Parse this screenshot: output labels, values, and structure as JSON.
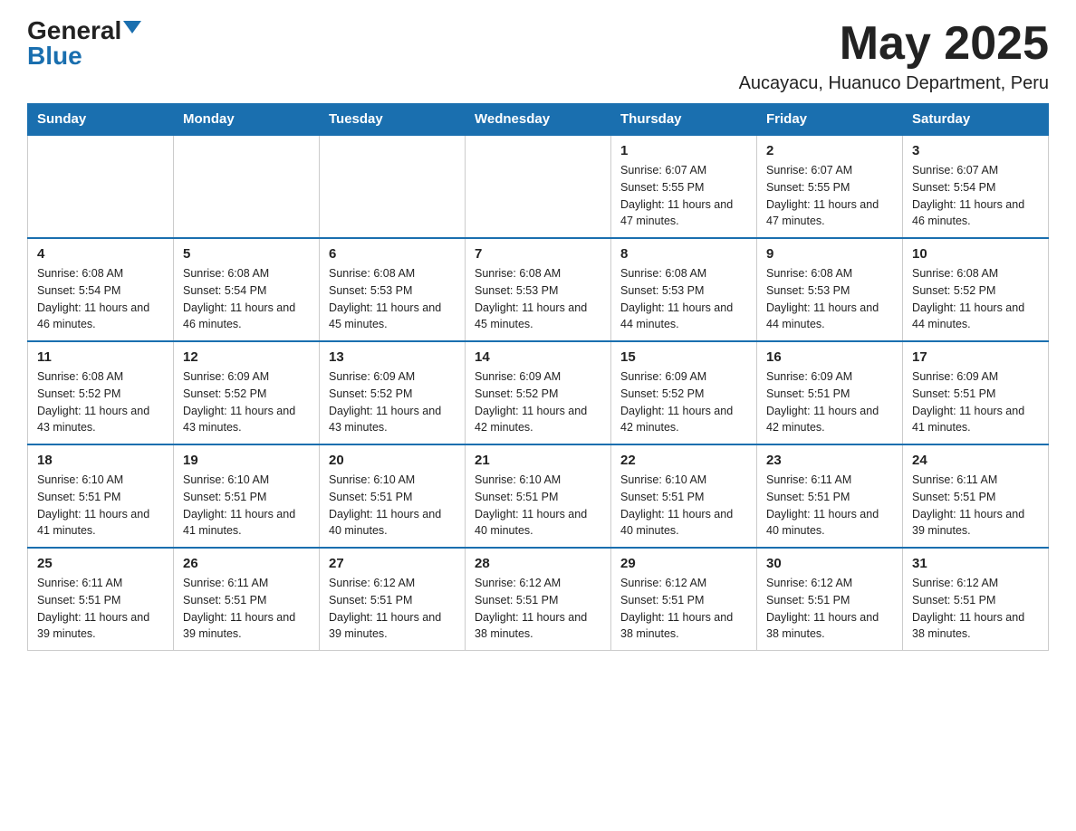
{
  "logo": {
    "general": "General",
    "blue": "Blue"
  },
  "title": "May 2025",
  "subtitle": "Aucayacu, Huanuco Department, Peru",
  "days_of_week": [
    "Sunday",
    "Monday",
    "Tuesday",
    "Wednesday",
    "Thursday",
    "Friday",
    "Saturday"
  ],
  "weeks": [
    [
      {
        "day": "",
        "info": ""
      },
      {
        "day": "",
        "info": ""
      },
      {
        "day": "",
        "info": ""
      },
      {
        "day": "",
        "info": ""
      },
      {
        "day": "1",
        "info": "Sunrise: 6:07 AM\nSunset: 5:55 PM\nDaylight: 11 hours and 47 minutes."
      },
      {
        "day": "2",
        "info": "Sunrise: 6:07 AM\nSunset: 5:55 PM\nDaylight: 11 hours and 47 minutes."
      },
      {
        "day": "3",
        "info": "Sunrise: 6:07 AM\nSunset: 5:54 PM\nDaylight: 11 hours and 46 minutes."
      }
    ],
    [
      {
        "day": "4",
        "info": "Sunrise: 6:08 AM\nSunset: 5:54 PM\nDaylight: 11 hours and 46 minutes."
      },
      {
        "day": "5",
        "info": "Sunrise: 6:08 AM\nSunset: 5:54 PM\nDaylight: 11 hours and 46 minutes."
      },
      {
        "day": "6",
        "info": "Sunrise: 6:08 AM\nSunset: 5:53 PM\nDaylight: 11 hours and 45 minutes."
      },
      {
        "day": "7",
        "info": "Sunrise: 6:08 AM\nSunset: 5:53 PM\nDaylight: 11 hours and 45 minutes."
      },
      {
        "day": "8",
        "info": "Sunrise: 6:08 AM\nSunset: 5:53 PM\nDaylight: 11 hours and 44 minutes."
      },
      {
        "day": "9",
        "info": "Sunrise: 6:08 AM\nSunset: 5:53 PM\nDaylight: 11 hours and 44 minutes."
      },
      {
        "day": "10",
        "info": "Sunrise: 6:08 AM\nSunset: 5:52 PM\nDaylight: 11 hours and 44 minutes."
      }
    ],
    [
      {
        "day": "11",
        "info": "Sunrise: 6:08 AM\nSunset: 5:52 PM\nDaylight: 11 hours and 43 minutes."
      },
      {
        "day": "12",
        "info": "Sunrise: 6:09 AM\nSunset: 5:52 PM\nDaylight: 11 hours and 43 minutes."
      },
      {
        "day": "13",
        "info": "Sunrise: 6:09 AM\nSunset: 5:52 PM\nDaylight: 11 hours and 43 minutes."
      },
      {
        "day": "14",
        "info": "Sunrise: 6:09 AM\nSunset: 5:52 PM\nDaylight: 11 hours and 42 minutes."
      },
      {
        "day": "15",
        "info": "Sunrise: 6:09 AM\nSunset: 5:52 PM\nDaylight: 11 hours and 42 minutes."
      },
      {
        "day": "16",
        "info": "Sunrise: 6:09 AM\nSunset: 5:51 PM\nDaylight: 11 hours and 42 minutes."
      },
      {
        "day": "17",
        "info": "Sunrise: 6:09 AM\nSunset: 5:51 PM\nDaylight: 11 hours and 41 minutes."
      }
    ],
    [
      {
        "day": "18",
        "info": "Sunrise: 6:10 AM\nSunset: 5:51 PM\nDaylight: 11 hours and 41 minutes."
      },
      {
        "day": "19",
        "info": "Sunrise: 6:10 AM\nSunset: 5:51 PM\nDaylight: 11 hours and 41 minutes."
      },
      {
        "day": "20",
        "info": "Sunrise: 6:10 AM\nSunset: 5:51 PM\nDaylight: 11 hours and 40 minutes."
      },
      {
        "day": "21",
        "info": "Sunrise: 6:10 AM\nSunset: 5:51 PM\nDaylight: 11 hours and 40 minutes."
      },
      {
        "day": "22",
        "info": "Sunrise: 6:10 AM\nSunset: 5:51 PM\nDaylight: 11 hours and 40 minutes."
      },
      {
        "day": "23",
        "info": "Sunrise: 6:11 AM\nSunset: 5:51 PM\nDaylight: 11 hours and 40 minutes."
      },
      {
        "day": "24",
        "info": "Sunrise: 6:11 AM\nSunset: 5:51 PM\nDaylight: 11 hours and 39 minutes."
      }
    ],
    [
      {
        "day": "25",
        "info": "Sunrise: 6:11 AM\nSunset: 5:51 PM\nDaylight: 11 hours and 39 minutes."
      },
      {
        "day": "26",
        "info": "Sunrise: 6:11 AM\nSunset: 5:51 PM\nDaylight: 11 hours and 39 minutes."
      },
      {
        "day": "27",
        "info": "Sunrise: 6:12 AM\nSunset: 5:51 PM\nDaylight: 11 hours and 39 minutes."
      },
      {
        "day": "28",
        "info": "Sunrise: 6:12 AM\nSunset: 5:51 PM\nDaylight: 11 hours and 38 minutes."
      },
      {
        "day": "29",
        "info": "Sunrise: 6:12 AM\nSunset: 5:51 PM\nDaylight: 11 hours and 38 minutes."
      },
      {
        "day": "30",
        "info": "Sunrise: 6:12 AM\nSunset: 5:51 PM\nDaylight: 11 hours and 38 minutes."
      },
      {
        "day": "31",
        "info": "Sunrise: 6:12 AM\nSunset: 5:51 PM\nDaylight: 11 hours and 38 minutes."
      }
    ]
  ]
}
